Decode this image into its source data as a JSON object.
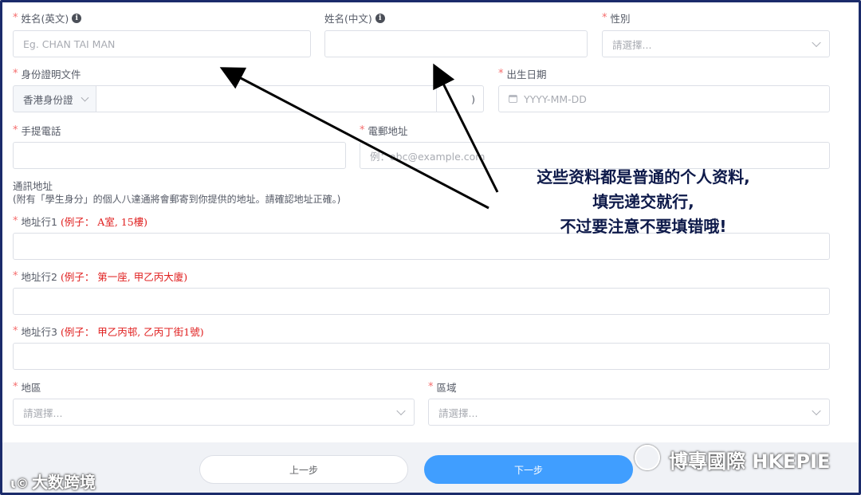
{
  "fields": {
    "name_en": {
      "label": "姓名(英文)",
      "placeholder": "Eg. CHAN TAI MAN"
    },
    "name_cn": {
      "label": "姓名(中文)",
      "placeholder": ""
    },
    "gender": {
      "label": "性別",
      "placeholder": "請選擇..."
    },
    "id_doc": {
      "label": "身份證明文件",
      "type_value": "香港身份證",
      "suffix": ")"
    },
    "dob": {
      "label": "出生日期",
      "placeholder": "YYYY-MM-DD"
    },
    "mobile": {
      "label": "手提電話",
      "placeholder": ""
    },
    "email": {
      "label": "電郵地址",
      "placeholder": "例：abc@example.com"
    },
    "address": {
      "title": "通訊地址",
      "note": "(附有「學生身分」的個人八達通將會郵寄到你提供的地址。請確認地址正確。)",
      "line1": {
        "label": "地址行1",
        "hint": "(例子： A室, 15樓)"
      },
      "line2": {
        "label": "地址行2",
        "hint": "(例子： 第一座, 甲乙丙大廈)"
      },
      "line3": {
        "label": "地址行3",
        "hint": "(例子： 甲乙丙邨, 乙丙丁街1號)"
      }
    },
    "district": {
      "label": "地區",
      "placeholder": "請選擇..."
    },
    "area": {
      "label": "區域",
      "placeholder": "請選擇..."
    }
  },
  "footer": {
    "prev_label": "上一步",
    "next_label": "下一步"
  },
  "annotation": {
    "lines": [
      "这些资料都是普通的个人资料,",
      "填完递交就行,",
      "不过要注意不要填错哦!"
    ]
  },
  "watermarks": {
    "left": "大数跨境",
    "right": "博專國際 HKEPIE"
  },
  "colors": {
    "accent": "#409eff",
    "required": "#f56c6c",
    "hint": "#e02020",
    "frame": "#1b2b6b",
    "annotation": "#0e1a4a"
  },
  "icons": {
    "info": "info-icon",
    "dropdown": "chevron-down-icon",
    "calendar": "calendar-icon",
    "arrow": "arrow-annotation"
  }
}
